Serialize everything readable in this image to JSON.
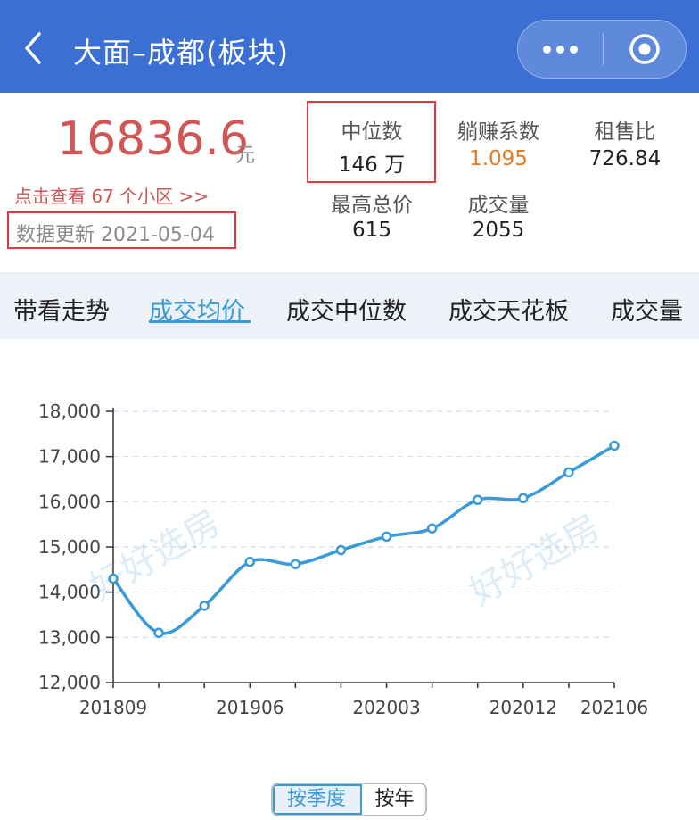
{
  "header": {
    "title": "大面–成都(板块)"
  },
  "summary": {
    "price": "16836.6",
    "price_unit": "元",
    "link_text": "点击查看 67 个小区 >>",
    "update_text": "数据更新 2021-05-04",
    "stats": [
      {
        "label": "中位数",
        "value": "146 万"
      },
      {
        "label": "躺赚系数",
        "value": "1.095",
        "color": "#e57a22"
      },
      {
        "label": "租售比",
        "value": "726.84"
      },
      {
        "label": "最高总价",
        "value": "615"
      },
      {
        "label": "成交量",
        "value": "2055"
      }
    ]
  },
  "tabs": [
    "带看走势",
    "成交均价",
    "成交中位数",
    "成交天花板",
    "成交量"
  ],
  "active_tab": "成交均价",
  "watermark": "好好选房",
  "colors": {
    "header": "#3c6fd3",
    "accent": "#3a9ad8",
    "price": "#d25556",
    "highlight_box": "#e2393b"
  },
  "chart_data": {
    "type": "line",
    "x": [
      "201809",
      "201812",
      "201903",
      "201906",
      "201909",
      "201912",
      "202003",
      "202006",
      "202009",
      "202012",
      "202103",
      "202106"
    ],
    "values": [
      14300,
      13100,
      13700,
      14670,
      14620,
      14930,
      15230,
      15410,
      16040,
      16080,
      16650,
      17240
    ],
    "y_ticks": [
      "12,000",
      "13,000",
      "14,000",
      "15,000",
      "16,000",
      "17,000",
      "18,000"
    ],
    "x_tick_labels": [
      "201809",
      "201906",
      "202003",
      "202012",
      "202106"
    ],
    "ylim": [
      12000,
      18000
    ],
    "grid": true,
    "line_color": "#3a9ad8"
  },
  "toggle": {
    "quarter": "按季度",
    "year": "按年"
  }
}
